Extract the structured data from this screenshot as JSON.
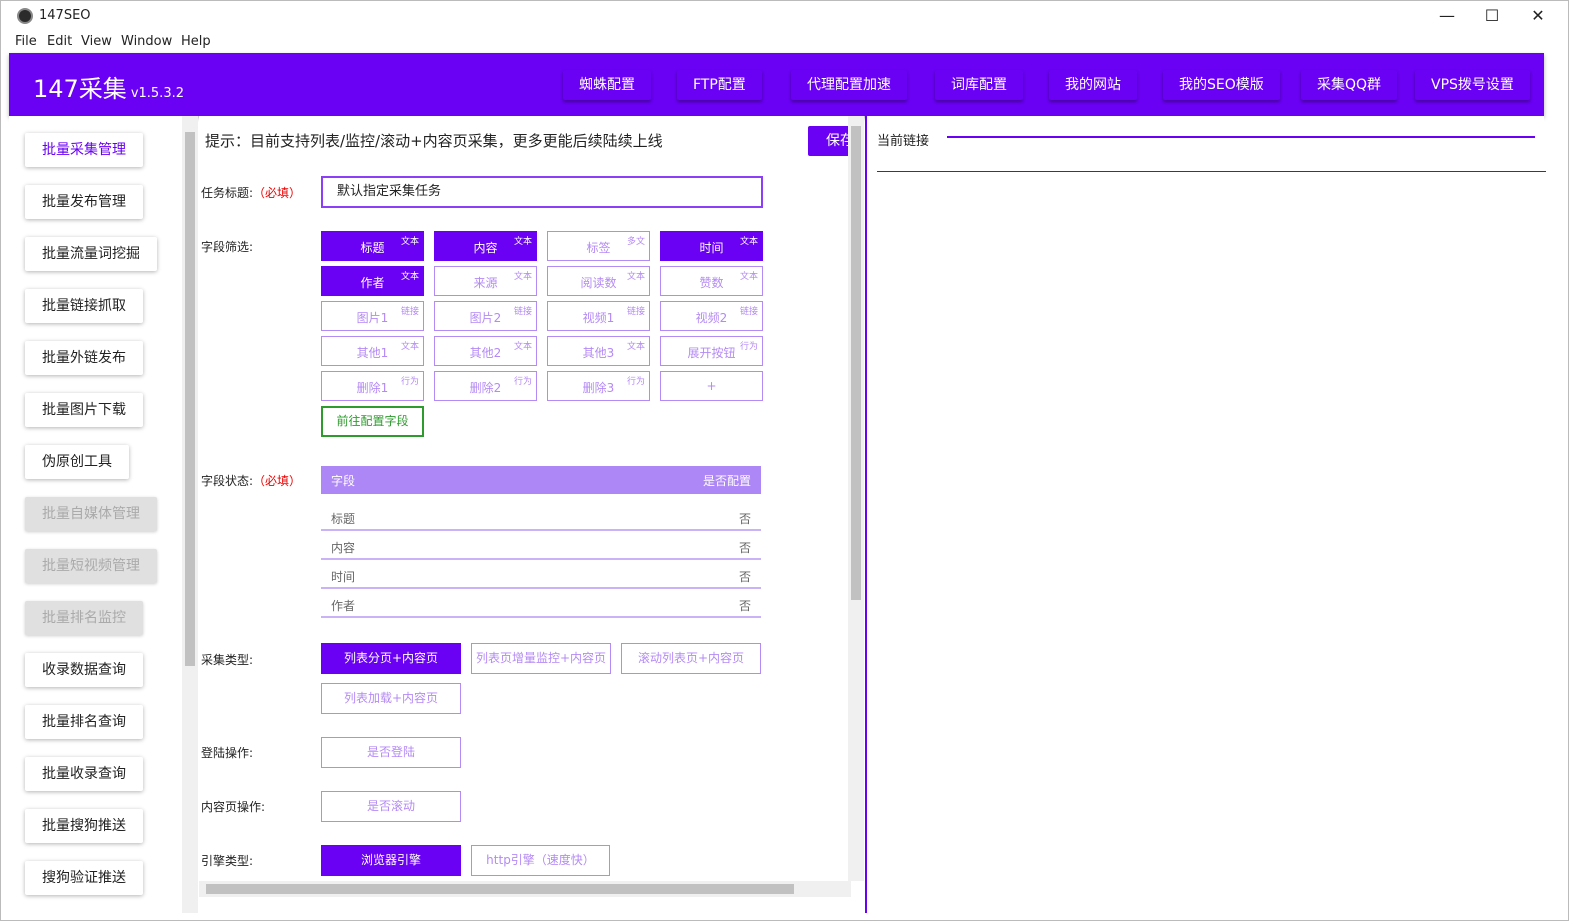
{
  "window": {
    "title": "147SEO",
    "minimize": "—",
    "maximize": "☐",
    "close": "✕"
  },
  "menu": [
    "File",
    "Edit",
    "View",
    "Window",
    "Help"
  ],
  "brand": {
    "name": "147采集",
    "version": "v1.5.3.2",
    "color": "#6a00f4"
  },
  "nav": [
    "蜘蛛配置",
    "FTP配置",
    "代理配置加速",
    "词库配置",
    "我的网站",
    "我的SEO模版",
    "采集QQ群",
    "VPS拨号设置"
  ],
  "sidebar": [
    {
      "label": "批量采集管理",
      "state": "active"
    },
    {
      "label": "批量发布管理",
      "state": "normal"
    },
    {
      "label": "批量流量词挖掘",
      "state": "normal"
    },
    {
      "label": "批量链接抓取",
      "state": "normal"
    },
    {
      "label": "批量外链发布",
      "state": "normal"
    },
    {
      "label": "批量图片下载",
      "state": "normal"
    },
    {
      "label": "伪原创工具",
      "state": "normal"
    },
    {
      "label": "批量自媒体管理",
      "state": "disabled"
    },
    {
      "label": "批量短视频管理",
      "state": "disabled"
    },
    {
      "label": "批量排名监控",
      "state": "disabled"
    },
    {
      "label": "收录数据查询",
      "state": "normal"
    },
    {
      "label": "批量排名查询",
      "state": "normal"
    },
    {
      "label": "批量收录查询",
      "state": "normal"
    },
    {
      "label": "批量搜狗推送",
      "state": "normal"
    },
    {
      "label": "搜狗验证推送",
      "state": "normal"
    }
  ],
  "main": {
    "tip": "提示：目前支持列表/监控/滚动+内容页采集，更多更能后续陆续上线",
    "save_label": "保存",
    "task_title": {
      "label": "任务标题:",
      "required": "（必填）",
      "value": "默认指定采集任务"
    },
    "field_filter": {
      "label": "字段筛选:",
      "chips": [
        {
          "name": "标题",
          "tag": "文本",
          "selected": true
        },
        {
          "name": "内容",
          "tag": "文本",
          "selected": true
        },
        {
          "name": "标签",
          "tag": "多文",
          "selected": false
        },
        {
          "name": "时间",
          "tag": "文本",
          "selected": true
        },
        {
          "name": "作者",
          "tag": "文本",
          "selected": true
        },
        {
          "name": "来源",
          "tag": "文本",
          "selected": false
        },
        {
          "name": "阅读数",
          "tag": "文本",
          "selected": false
        },
        {
          "name": "赞数",
          "tag": "文本",
          "selected": false
        },
        {
          "name": "图片1",
          "tag": "链接",
          "selected": false
        },
        {
          "name": "图片2",
          "tag": "链接",
          "selected": false
        },
        {
          "name": "视频1",
          "tag": "链接",
          "selected": false
        },
        {
          "name": "视频2",
          "tag": "链接",
          "selected": false
        },
        {
          "name": "其他1",
          "tag": "文本",
          "selected": false
        },
        {
          "name": "其他2",
          "tag": "文本",
          "selected": false
        },
        {
          "name": "其他3",
          "tag": "文本",
          "selected": false
        },
        {
          "name": "展开按钮",
          "tag": "行为",
          "selected": false
        },
        {
          "name": "删除1",
          "tag": "行为",
          "selected": false
        },
        {
          "name": "删除2",
          "tag": "行为",
          "selected": false
        },
        {
          "name": "删除3",
          "tag": "行为",
          "selected": false
        },
        {
          "name": "+",
          "tag": "",
          "selected": false
        }
      ],
      "goto_label": "前往配置字段"
    },
    "field_status": {
      "label": "字段状态:",
      "required": "（必填）",
      "headers": [
        "字段",
        "是否配置"
      ],
      "rows": [
        [
          "标题",
          "否"
        ],
        [
          "内容",
          "否"
        ],
        [
          "时间",
          "否"
        ],
        [
          "作者",
          "否"
        ]
      ]
    },
    "collect_type": {
      "label": "采集类型:",
      "options": [
        {
          "label": "列表分页+内容页",
          "selected": true
        },
        {
          "label": "列表页增量监控+内容页",
          "selected": false
        },
        {
          "label": "滚动列表页+内容页",
          "selected": false
        },
        {
          "label": "列表加载+内容页",
          "selected": false
        }
      ]
    },
    "login": {
      "label": "登陆操作:",
      "button": "是否登陆"
    },
    "content_op": {
      "label": "内容页操作:",
      "button": "是否滚动"
    },
    "engine": {
      "label": "引擎类型:",
      "options": [
        {
          "label": "浏览器引擎",
          "selected": true
        },
        {
          "label": "http引擎（速度快）",
          "selected": false
        }
      ]
    }
  },
  "right_panel": {
    "label": "当前链接"
  }
}
